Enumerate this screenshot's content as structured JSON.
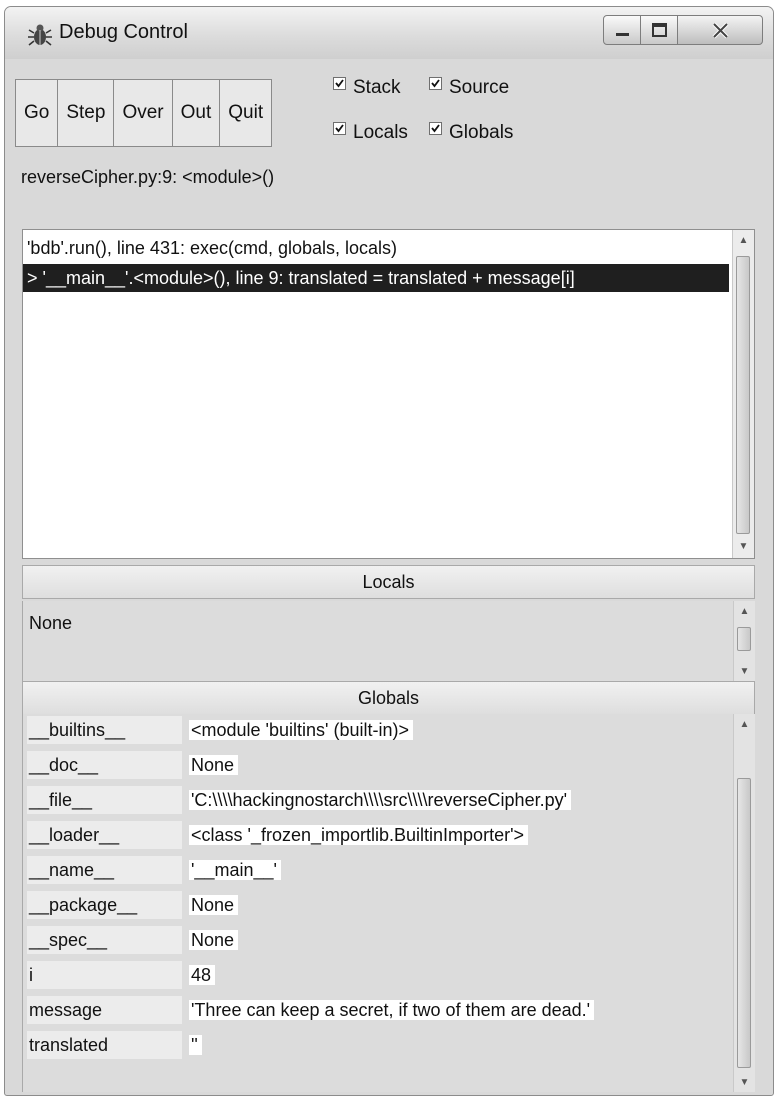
{
  "window": {
    "title": "Debug Control"
  },
  "toolbar": {
    "buttons": [
      "Go",
      "Step",
      "Over",
      "Out",
      "Quit"
    ]
  },
  "options": {
    "stack": {
      "label": "Stack",
      "checked": true
    },
    "source": {
      "label": "Source",
      "checked": true
    },
    "locals": {
      "label": "Locals",
      "checked": true
    },
    "globals": {
      "label": "Globals",
      "checked": true
    }
  },
  "status": "reverseCipher.py:9: <module>()",
  "stack_frames": [
    "'bdb'.run(), line 431: exec(cmd, globals, locals)",
    "> '__main__'.<module>(), line 9: translated = translated + message[i]"
  ],
  "locals_panel": {
    "header": "Locals",
    "content": "None"
  },
  "globals_panel": {
    "header": "Globals",
    "rows": [
      {
        "name": "__builtins__",
        "value": "<module 'builtins' (built-in)>"
      },
      {
        "name": "__doc__",
        "value": "None"
      },
      {
        "name": "__file__",
        "value": "'C:\\\\\\\\hackingnostarch\\\\\\\\src\\\\\\\\reverseCipher.py'"
      },
      {
        "name": "__loader__",
        "value": "<class '_frozen_importlib.BuiltinImporter'>"
      },
      {
        "name": "__name__",
        "value": "'__main__'"
      },
      {
        "name": "__package__",
        "value": "None"
      },
      {
        "name": "__spec__",
        "value": "None"
      },
      {
        "name": "i",
        "value": "48"
      },
      {
        "name": "message",
        "value": "'Three can keep a secret, if two of them are dead.'"
      },
      {
        "name": "translated",
        "value": "''"
      }
    ]
  }
}
